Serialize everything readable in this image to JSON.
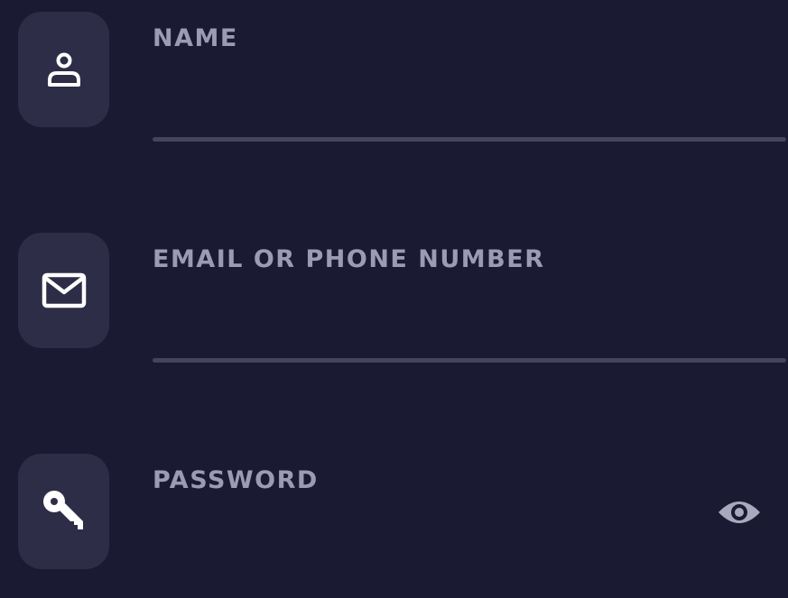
{
  "form": {
    "fields": [
      {
        "label": "NAME",
        "icon": "person-icon",
        "value": "",
        "placeholder": ""
      },
      {
        "label": "EMAIL OR PHONE NUMBER",
        "icon": "mail-icon",
        "value": "",
        "placeholder": ""
      },
      {
        "label": "PASSWORD",
        "icon": "key-icon",
        "value": "",
        "placeholder": "",
        "toggle_icon": "eye-icon"
      }
    ]
  },
  "colors": {
    "background": "#1b1a33",
    "tile": "#2e2d47",
    "label": "#9c9bb3",
    "underline": "#45445c",
    "icon": "#ffffff",
    "eye_icon": "#a9a8bd"
  }
}
